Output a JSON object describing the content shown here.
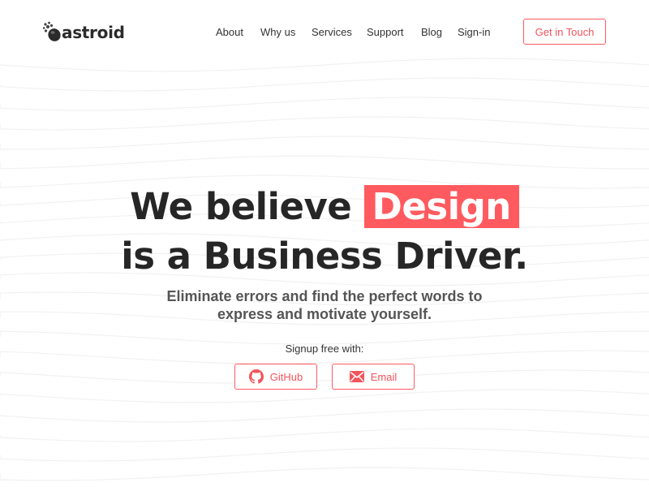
{
  "brand": {
    "name": "astroid",
    "logo_icon": "asteroid-logo-icon"
  },
  "nav": {
    "items": [
      {
        "label": "About"
      },
      {
        "label": "Why us"
      },
      {
        "label": "Services"
      },
      {
        "label": "Support"
      },
      {
        "label": "Blog"
      },
      {
        "label": "Sign-in"
      }
    ],
    "cta_label": "Get in Touch"
  },
  "hero": {
    "headline_prefix": "We believe",
    "headline_highlight": "Design",
    "headline_line2": "is a Business Driver.",
    "subhead_line1": "Eliminate errors and find the perfect words to",
    "subhead_line2": "express and motivate yourself.",
    "signup_label": "Signup free with:",
    "buttons": {
      "github": {
        "label": "GitHub",
        "icon": "github-icon"
      },
      "email": {
        "label": "Email",
        "icon": "mail-icon"
      }
    }
  },
  "colors": {
    "accent": "#ff5a5f",
    "text": "#262626",
    "muted": "#555555",
    "background": "#ffffff"
  }
}
